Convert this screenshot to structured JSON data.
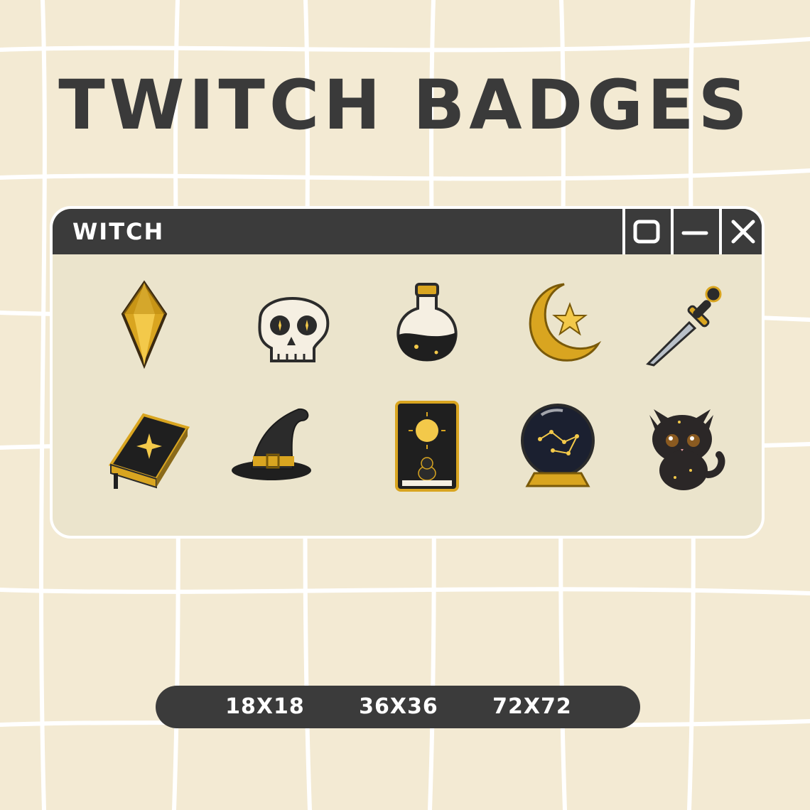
{
  "title": "TWITCH BADGES",
  "window": {
    "title": "WITCH",
    "controls": [
      {
        "name": "maximize",
        "icon": "square-icon"
      },
      {
        "name": "minimize",
        "icon": "minus-icon"
      },
      {
        "name": "close",
        "icon": "close-icon"
      }
    ]
  },
  "badges": [
    {
      "name": "crystal",
      "icon": "gold-crystal-icon"
    },
    {
      "name": "skull",
      "icon": "skull-icon"
    },
    {
      "name": "potion",
      "icon": "potion-bottle-icon"
    },
    {
      "name": "moon",
      "icon": "crescent-moon-star-icon"
    },
    {
      "name": "dagger",
      "icon": "dagger-icon"
    },
    {
      "name": "spellbook",
      "icon": "spellbook-icon"
    },
    {
      "name": "witch-hat",
      "icon": "witch-hat-icon"
    },
    {
      "name": "tarot-card",
      "icon": "tarot-card-icon"
    },
    {
      "name": "crystal-ball",
      "icon": "crystal-ball-icon"
    },
    {
      "name": "black-cat",
      "icon": "black-cat-icon"
    }
  ],
  "sizes": [
    "18X18",
    "36X36",
    "72X72"
  ],
  "colors": {
    "background": "#f3ead3",
    "dark": "#3b3b3b",
    "window": "#ebe4cc",
    "gold": "#d9a520"
  }
}
